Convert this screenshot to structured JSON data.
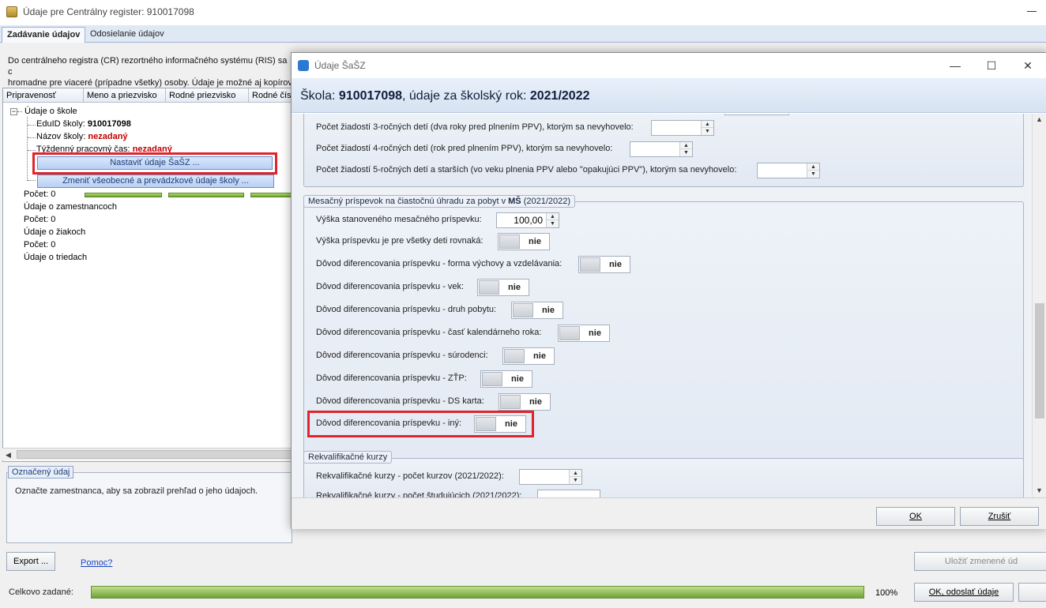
{
  "main": {
    "title": "Údaje pre Centrálny register: 910017098",
    "tabs": [
      "Zadávanie údajov",
      "Odosielanie údajov"
    ],
    "description_lines": [
      "Do centrálneho registra (CR) rezortného informačného systému (RIS) sa c",
      "hromadne pre viaceré (prípadne všetky) osoby. Údaje je možné aj kopírov"
    ],
    "grid_headers": [
      "Pripravenosť",
      "Meno a priezvisko",
      "Rodné priezvisko",
      "Rodné čís"
    ],
    "tree": {
      "school_node": "Údaje o škole",
      "eduid_label": "EduID školy:",
      "eduid_value": "910017098",
      "name_label": "Názov školy:",
      "name_value": "nezadaný",
      "week_label": "Týždenný pracovný čas:",
      "week_value": "nezadaný",
      "set_button": "Nastaviť údaje ŠaŠZ ...",
      "change_button": "Zmeniť všeobecné a prevádzkové údaje školy ...",
      "count0": "Počet: 0",
      "employees": "Údaje o zamestnancoch",
      "count1": "Počet: 0",
      "pupils": "Údaje o žiakoch",
      "count2": "Počet: 0",
      "classes": "Údaje o triedach"
    },
    "marked_legend": "Označený údaj",
    "marked_text": "Označte zamestnanca, aby sa zobrazil prehľad o jeho údajoch.",
    "export_button": "Export ...",
    "help_link": "Pomoc?",
    "save_button": "Uložiť zmenené úd",
    "total_label": "Celkovo zadané:",
    "total_progress": 1.0,
    "total_pct": "100%",
    "ok_send_button": "OK, odoslať údaje"
  },
  "dialog": {
    "title": "Údaje ŠaŠZ",
    "header_prefix": "Škola: ",
    "school_id": "910017098",
    "header_mid": ", údaje za školský rok: ",
    "school_year": "2021/2022",
    "top_rows": [
      "Počet žiadostí 3-ročných detí (dva roky pred plnením PPV), ktorým sa nevyhovelo:",
      "Počet žiadostí 4-ročných detí (rok pred plnením PPV), ktorým sa nevyhovelo:",
      "Počet žiadostí 5-ročných detí a starších (vo veku plnenia PPV alebo \"opakujúci PPV\"), ktorým sa nevyhovelo:"
    ],
    "contribution_legend": "Mesačný príspevok na čiastočnú úhradu za pobyt v ",
    "contribution_legend_bold": "MŠ",
    "contribution_legend_suffix": " (2021/2022)",
    "amount_label": "Výška stanoveného mesačného príspevku:",
    "amount_value": "100,00",
    "toggle_rows": [
      "Výška príspevku je pre všetky deti rovnaká:",
      "Dôvod diferencovania príspevku - forma výchovy a vzdelávania:",
      "Dôvod diferencovania príspevku - vek:",
      "Dôvod diferencovania príspevku - druh pobytu:",
      "Dôvod diferencovania príspevku - časť kalendárneho roka:",
      "Dôvod diferencovania príspevku - súrodenci:",
      "Dôvod diferencovania príspevku - ZŤP:",
      "Dôvod diferencovania príspevku - DS karta:",
      "Dôvod diferencovania príspevku - iný:"
    ],
    "toggle_state": "nie",
    "retrain_legend": "Rekvalifikačné kurzy",
    "retrain_rows": [
      "Rekvalifikačné kurzy - počet kurzov (2021/2022):",
      "Rekvalifikačné kurzy - počet študujúcich (2021/2022):"
    ],
    "ok_button": "OK",
    "cancel_button": "Zrušiť"
  },
  "colors": {
    "highlight": "#e0242b",
    "link": "#1a43c8",
    "required": "#c00000"
  }
}
